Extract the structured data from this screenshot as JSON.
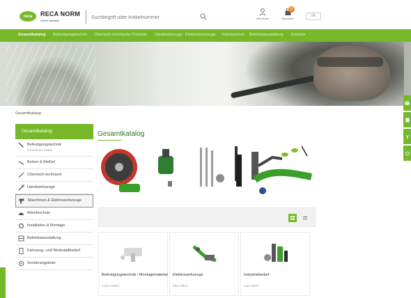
{
  "header": {
    "logo_mark": "reca",
    "logo_name": "RECA NORM",
    "logo_tagline": "GmbH Anbieter",
    "search_placeholder": "Suchbegriff oder Artikelnummer",
    "icons": [
      {
        "name": "account-icon",
        "label": "Mein Konto"
      },
      {
        "name": "cart-icon",
        "label": "Warenkorb",
        "badge": "0"
      }
    ],
    "language": "DE"
  },
  "nav": {
    "items": [
      {
        "label": "Gesamtkatalog",
        "active": true
      },
      {
        "label": "Befestigungstechnik"
      },
      {
        "label": "Chemisch-technische Produkte"
      },
      {
        "label": "Handwerkzeuge"
      },
      {
        "label": "Elektrowerkzeuge"
      },
      {
        "label": "Arbeitsschutz"
      },
      {
        "label": "Betriebsausstattung"
      },
      {
        "label": "Zubehör"
      }
    ]
  },
  "breadcrumb": "Gesamtkatalog",
  "sidebar": {
    "heading": "Gesamtkatalog",
    "items": [
      {
        "icon": "screw-icon",
        "label": "Befestigungstechnik",
        "sub": "Schrauben, Dübel"
      },
      {
        "icon": "drill-bit-icon",
        "label": "Bohrer & Meißel"
      },
      {
        "icon": "spray-icon",
        "label": "Chemisch-technisch"
      },
      {
        "icon": "wrench-icon",
        "label": "Handwerkzeuge"
      },
      {
        "icon": "power-tool-icon",
        "label": "Maschinen & Elektrowerkzeuge",
        "boxed": true
      },
      {
        "icon": "helmet-icon",
        "label": "Arbeitsschutz"
      },
      {
        "icon": "pipe-icon",
        "label": "Installation & Montage"
      },
      {
        "icon": "shelf-icon",
        "label": "Betriebsausstattung"
      },
      {
        "icon": "car-battery-icon",
        "label": "Fahrzeug- und Werkstattbedarf"
      },
      {
        "icon": "tag-icon",
        "label": "Sonderangebote"
      }
    ]
  },
  "main": {
    "title": "Gesamtkatalog",
    "cards": [
      {
        "title": "Befestigungstechnik / Montagematerial",
        "count": "1.234 Artikel"
      },
      {
        "title": "Elektrowerkzeuge",
        "count": "562 Artikel"
      },
      {
        "title": "Industriebedarf",
        "count": "318 Artikel"
      }
    ]
  },
  "colors": {
    "brand_green": "#76b82a",
    "dark_green": "#5e9b1d",
    "badge_orange": "#f28a1f"
  }
}
